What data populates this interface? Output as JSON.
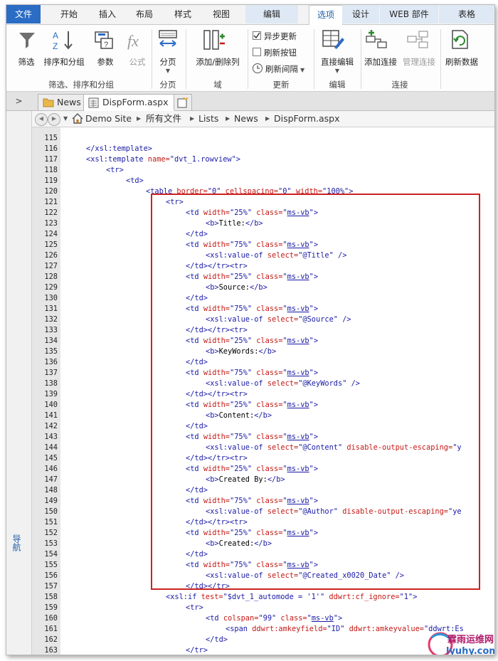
{
  "ribbon_tabs": [
    "文件",
    "开始",
    "插入",
    "布局",
    "样式",
    "视图",
    "编辑",
    "选项",
    "设计",
    "WEB 部件",
    "表格"
  ],
  "ribbon": {
    "filter": "筛选",
    "sort_group": "排序和分组",
    "params": "参数",
    "formula": "公式",
    "paging": "分页",
    "add_remove_cols": "添加/删除列",
    "async_update": "异步更新",
    "refresh_button": "刷新按钮",
    "refresh_interval": "刷新间隔",
    "direct_edit": "直接编辑",
    "add_connection": "添加连接",
    "manage_connections": "管理连接",
    "refresh_data": "刷新数据",
    "groups": {
      "filter_sort_group": "筛选、排序和分组",
      "paging": "分页",
      "fields": "域",
      "update": "更新",
      "edit": "编辑",
      "connections": "连接"
    }
  },
  "doc_tabs": [
    "News",
    "DispForm.aspx"
  ],
  "breadcrumb": [
    "Demo Site",
    "所有文件",
    "Lists",
    "News",
    "DispForm.aspx"
  ],
  "left_nav_label": "导航",
  "line_numbers": [
    "115",
    "116",
    "117",
    "118",
    "119",
    "120",
    "121",
    "122",
    "123",
    "124",
    "125",
    "126",
    "127",
    "128",
    "129",
    "130",
    "131",
    "132",
    "133",
    "134",
    "135",
    "136",
    "137",
    "138",
    "139",
    "140",
    "141",
    "142",
    "143",
    "144",
    "145",
    "146",
    "147",
    "148",
    "149",
    "150",
    "151",
    "152",
    "153",
    "154",
    "155",
    "156",
    "157",
    "158",
    "159",
    "160",
    "161",
    "162",
    "163"
  ],
  "code_lines": [
    [],
    [
      [
        "t",
        "</xsl:template>"
      ]
    ],
    [
      [
        "t",
        "<xsl:template "
      ],
      [
        "a",
        "name="
      ],
      [
        "v",
        "\"dvt_1.rowview\""
      ],
      [
        "t",
        ">"
      ]
    ],
    [
      [
        "t",
        "<tr>"
      ]
    ],
    [
      [
        "t",
        "<td>"
      ]
    ],
    [
      [
        "t",
        "<table "
      ],
      [
        "a",
        "border="
      ],
      [
        "v",
        "\"0\" "
      ],
      [
        "a",
        "cellspacing="
      ],
      [
        "v",
        "\"0\" "
      ],
      [
        "a",
        "width="
      ],
      [
        "v",
        "\"100%\""
      ],
      [
        "t",
        ">"
      ]
    ],
    [
      [
        "t",
        "<tr>"
      ]
    ],
    [
      [
        "t",
        "<td "
      ],
      [
        "a",
        "width="
      ],
      [
        "v",
        "\"25%\" "
      ],
      [
        "a",
        "class="
      ],
      [
        "v",
        "\""
      ],
      [
        "u",
        "ms-vb"
      ],
      [
        "v",
        "\""
      ],
      [
        "t",
        ">"
      ]
    ],
    [
      [
        "t",
        "<b>"
      ],
      [
        "x",
        "Title:"
      ],
      [
        "t",
        "</b>"
      ]
    ],
    [
      [
        "t",
        "</td>"
      ]
    ],
    [
      [
        "t",
        "<td "
      ],
      [
        "a",
        "width="
      ],
      [
        "v",
        "\"75%\" "
      ],
      [
        "a",
        "class="
      ],
      [
        "v",
        "\""
      ],
      [
        "u",
        "ms-vb"
      ],
      [
        "v",
        "\""
      ],
      [
        "t",
        ">"
      ]
    ],
    [
      [
        "t",
        "<xsl:value-of "
      ],
      [
        "a",
        "select="
      ],
      [
        "v",
        "\"@Title\" "
      ],
      [
        "t",
        "/>"
      ]
    ],
    [
      [
        "t",
        "</td></tr><tr>"
      ]
    ],
    [
      [
        "t",
        "<td "
      ],
      [
        "a",
        "width="
      ],
      [
        "v",
        "\"25%\" "
      ],
      [
        "a",
        "class="
      ],
      [
        "v",
        "\""
      ],
      [
        "u",
        "ms-vb"
      ],
      [
        "v",
        "\""
      ],
      [
        "t",
        ">"
      ]
    ],
    [
      [
        "t",
        "<b>"
      ],
      [
        "x",
        "Source:"
      ],
      [
        "t",
        "</b>"
      ]
    ],
    [
      [
        "t",
        "</td>"
      ]
    ],
    [
      [
        "t",
        "<td "
      ],
      [
        "a",
        "width="
      ],
      [
        "v",
        "\"75%\" "
      ],
      [
        "a",
        "class="
      ],
      [
        "v",
        "\""
      ],
      [
        "u",
        "ms-vb"
      ],
      [
        "v",
        "\""
      ],
      [
        "t",
        ">"
      ]
    ],
    [
      [
        "t",
        "<xsl:value-of "
      ],
      [
        "a",
        "select="
      ],
      [
        "v",
        "\"@Source\" "
      ],
      [
        "t",
        "/>"
      ]
    ],
    [
      [
        "t",
        "</td></tr><tr>"
      ]
    ],
    [
      [
        "t",
        "<td "
      ],
      [
        "a",
        "width="
      ],
      [
        "v",
        "\"25%\" "
      ],
      [
        "a",
        "class="
      ],
      [
        "v",
        "\""
      ],
      [
        "u",
        "ms-vb"
      ],
      [
        "v",
        "\""
      ],
      [
        "t",
        ">"
      ]
    ],
    [
      [
        "t",
        "<b>"
      ],
      [
        "x",
        "KeyWords:"
      ],
      [
        "t",
        "</b>"
      ]
    ],
    [
      [
        "t",
        "</td>"
      ]
    ],
    [
      [
        "t",
        "<td "
      ],
      [
        "a",
        "width="
      ],
      [
        "v",
        "\"75%\" "
      ],
      [
        "a",
        "class="
      ],
      [
        "v",
        "\""
      ],
      [
        "u",
        "ms-vb"
      ],
      [
        "v",
        "\""
      ],
      [
        "t",
        ">"
      ]
    ],
    [
      [
        "t",
        "<xsl:value-of "
      ],
      [
        "a",
        "select="
      ],
      [
        "v",
        "\"@KeyWords\" "
      ],
      [
        "t",
        "/>"
      ]
    ],
    [
      [
        "t",
        "</td></tr><tr>"
      ]
    ],
    [
      [
        "t",
        "<td "
      ],
      [
        "a",
        "width="
      ],
      [
        "v",
        "\"25%\" "
      ],
      [
        "a",
        "class="
      ],
      [
        "v",
        "\""
      ],
      [
        "u",
        "ms-vb"
      ],
      [
        "v",
        "\""
      ],
      [
        "t",
        ">"
      ]
    ],
    [
      [
        "t",
        "<b>"
      ],
      [
        "x",
        "Content:"
      ],
      [
        "t",
        "</b>"
      ]
    ],
    [
      [
        "t",
        "</td>"
      ]
    ],
    [
      [
        "t",
        "<td "
      ],
      [
        "a",
        "width="
      ],
      [
        "v",
        "\"75%\" "
      ],
      [
        "a",
        "class="
      ],
      [
        "v",
        "\""
      ],
      [
        "u",
        "ms-vb"
      ],
      [
        "v",
        "\""
      ],
      [
        "t",
        ">"
      ]
    ],
    [
      [
        "t",
        "<xsl:value-of "
      ],
      [
        "a",
        "select="
      ],
      [
        "v",
        "\"@Content\" "
      ],
      [
        "a",
        "disable-output-escaping="
      ],
      [
        "v",
        "\"y"
      ]
    ],
    [
      [
        "t",
        "</td></tr><tr>"
      ]
    ],
    [
      [
        "t",
        "<td "
      ],
      [
        "a",
        "width="
      ],
      [
        "v",
        "\"25%\" "
      ],
      [
        "a",
        "class="
      ],
      [
        "v",
        "\""
      ],
      [
        "u",
        "ms-vb"
      ],
      [
        "v",
        "\""
      ],
      [
        "t",
        ">"
      ]
    ],
    [
      [
        "t",
        "<b>"
      ],
      [
        "x",
        "Created By:"
      ],
      [
        "t",
        "</b>"
      ]
    ],
    [
      [
        "t",
        "</td>"
      ]
    ],
    [
      [
        "t",
        "<td "
      ],
      [
        "a",
        "width="
      ],
      [
        "v",
        "\"75%\" "
      ],
      [
        "a",
        "class="
      ],
      [
        "v",
        "\""
      ],
      [
        "u",
        "ms-vb"
      ],
      [
        "v",
        "\""
      ],
      [
        "t",
        ">"
      ]
    ],
    [
      [
        "t",
        "<xsl:value-of "
      ],
      [
        "a",
        "select="
      ],
      [
        "v",
        "\"@Author\" "
      ],
      [
        "a",
        "disable-output-escaping="
      ],
      [
        "v",
        "\"ye"
      ]
    ],
    [
      [
        "t",
        "</td></tr><tr>"
      ]
    ],
    [
      [
        "t",
        "<td "
      ],
      [
        "a",
        "width="
      ],
      [
        "v",
        "\"25%\" "
      ],
      [
        "a",
        "class="
      ],
      [
        "v",
        "\""
      ],
      [
        "u",
        "ms-vb"
      ],
      [
        "v",
        "\""
      ],
      [
        "t",
        ">"
      ]
    ],
    [
      [
        "t",
        "<b>"
      ],
      [
        "x",
        "Created:"
      ],
      [
        "t",
        "</b>"
      ]
    ],
    [
      [
        "t",
        "</td>"
      ]
    ],
    [
      [
        "t",
        "<td "
      ],
      [
        "a",
        "width="
      ],
      [
        "v",
        "\"75%\" "
      ],
      [
        "a",
        "class="
      ],
      [
        "v",
        "\""
      ],
      [
        "u",
        "ms-vb"
      ],
      [
        "v",
        "\""
      ],
      [
        "t",
        ">"
      ]
    ],
    [
      [
        "t",
        "<xsl:value-of "
      ],
      [
        "a",
        "select="
      ],
      [
        "v",
        "\"@Created_x0020_Date\" "
      ],
      [
        "t",
        "/>"
      ]
    ],
    [
      [
        "t",
        "</td></tr>"
      ]
    ],
    [
      [
        "t",
        "<xsl:if "
      ],
      [
        "a",
        "test="
      ],
      [
        "v",
        "\"$dvt_1_automode = '1'\" "
      ],
      [
        "a",
        "ddwrt:cf_ignore="
      ],
      [
        "v",
        "\"1\""
      ],
      [
        "t",
        ">"
      ]
    ],
    [
      [
        "t",
        "<tr>"
      ]
    ],
    [
      [
        "t",
        "<td "
      ],
      [
        "a",
        "colspan="
      ],
      [
        "v",
        "\"99\" "
      ],
      [
        "a",
        "class="
      ],
      [
        "v",
        "\""
      ],
      [
        "u",
        "ms-vb"
      ],
      [
        "v",
        "\""
      ],
      [
        "t",
        ">"
      ]
    ],
    [
      [
        "t",
        "<span "
      ],
      [
        "a",
        "ddwrt:amkeyfield="
      ],
      [
        "v",
        "\"ID\" "
      ],
      [
        "a",
        "ddwrt:amkeyvalue="
      ],
      [
        "v",
        "\"ddwrt:Es"
      ]
    ],
    [
      [
        "t",
        "</td>"
      ]
    ],
    [
      [
        "t",
        "</tr>"
      ]
    ]
  ],
  "watermark": {
    "brand": "霖雨运维网",
    "url": "lyuhy.com"
  }
}
